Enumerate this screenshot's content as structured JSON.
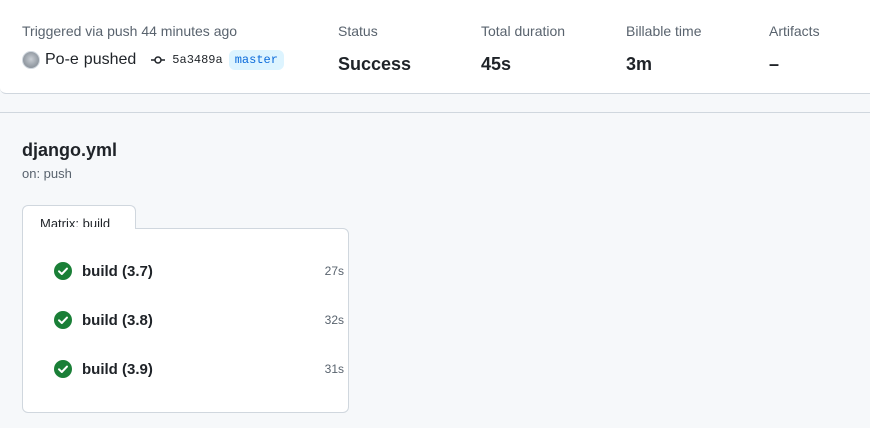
{
  "summary": {
    "trigger_label": "Triggered via push 44 minutes ago",
    "actor": "Po-e",
    "action": "pushed",
    "commit_sha": "5a3489a",
    "branch": "master",
    "status_label": "Status",
    "status_value": "Success",
    "duration_label": "Total duration",
    "duration_value": "45s",
    "billable_label": "Billable time",
    "billable_value": "3m",
    "artifacts_label": "Artifacts",
    "artifacts_value": "–"
  },
  "workflow": {
    "file": "django.yml",
    "trigger": "on: push",
    "matrix_label": "Matrix: build",
    "jobs": [
      {
        "name": "build (3.7)",
        "duration": "27s",
        "status": "success"
      },
      {
        "name": "build (3.8)",
        "duration": "32s",
        "status": "success"
      },
      {
        "name": "build (3.9)",
        "duration": "31s",
        "status": "success"
      }
    ]
  },
  "colors": {
    "success": "#1a7f37",
    "link": "#0969da",
    "muted": "#59636e"
  }
}
